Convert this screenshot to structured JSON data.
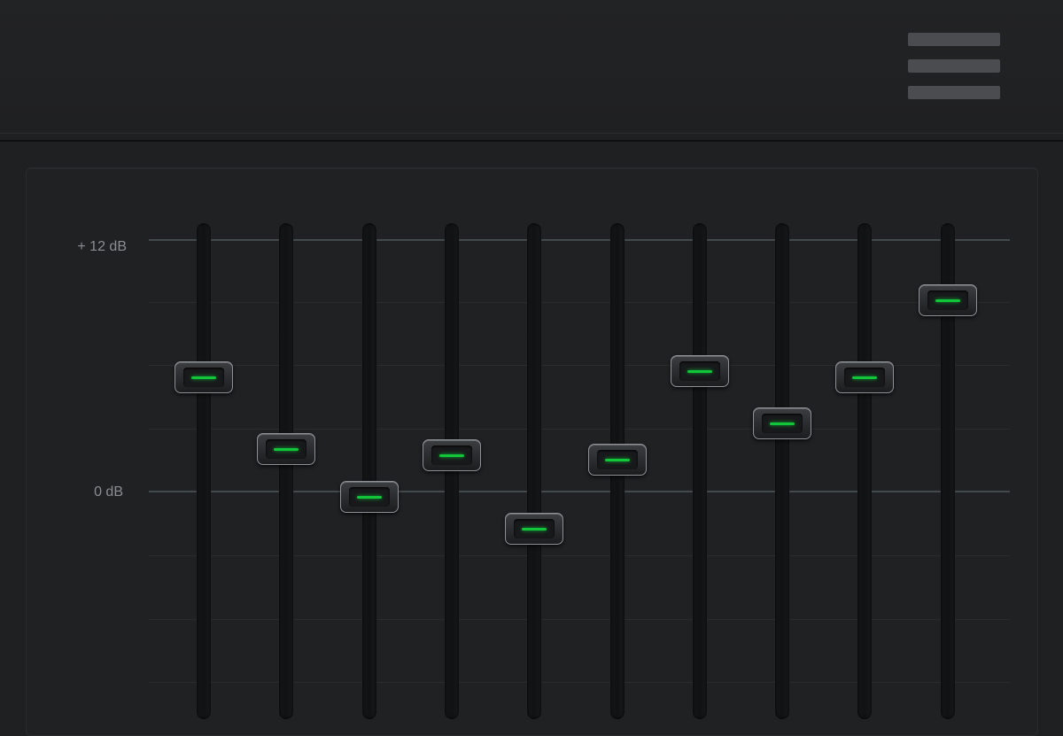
{
  "labels": {
    "top": "+ 12 dB",
    "zero": "0 dB"
  },
  "icons": {
    "menu": "hamburger-menu-icon"
  },
  "colors": {
    "led": "#11c63a",
    "background": "#1f2022"
  },
  "scale": {
    "max_db": 12,
    "min_db": 0
  },
  "sliders": [
    {
      "band": 1,
      "level_db": 5.4
    },
    {
      "band": 2,
      "level_db": 2.0
    },
    {
      "band": 3,
      "level_db": -0.3
    },
    {
      "band": 4,
      "level_db": 1.7
    },
    {
      "band": 5,
      "level_db": -1.8
    },
    {
      "band": 6,
      "level_db": 1.5
    },
    {
      "band": 7,
      "level_db": 5.7
    },
    {
      "band": 8,
      "level_db": 3.2
    },
    {
      "band": 9,
      "level_db": 5.4
    },
    {
      "band": 10,
      "level_db": 9.1
    }
  ]
}
